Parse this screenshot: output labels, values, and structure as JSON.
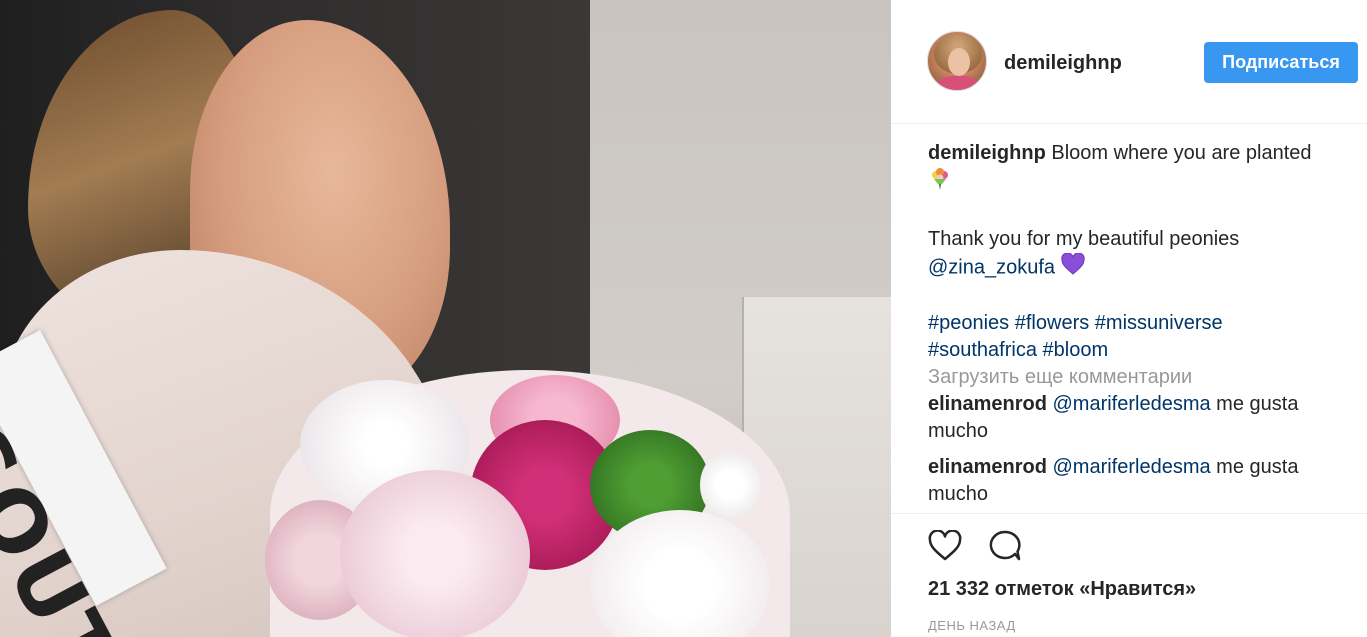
{
  "photo": {
    "sash_text": "SOUT"
  },
  "post": {
    "username": "demileighnp",
    "follow_label": "Подписаться",
    "caption": {
      "username": "demileighnp",
      "line1": "Bloom where you are planted",
      "line2": "Thank you for my beautiful peonies",
      "mention": "@zina_zokufa",
      "hashtags_line1": [
        "#peonies",
        "#flowers",
        "#missuniverse"
      ],
      "hashtags_line2": [
        "#southafrica",
        "#bloom"
      ]
    },
    "load_more": "Загрузить еще комментарии",
    "comments": [
      {
        "username": "elinamenrod",
        "mention": "@mariferledesma",
        "text": "me gusta mucho"
      },
      {
        "username": "elinamenrod",
        "mention": "@mariferledesma",
        "text": "me gusta mucho"
      }
    ],
    "likes": "21 332 отметок «Нравится»",
    "time": "ДЕНЬ НАЗАД"
  },
  "icons": {
    "like": "heart-outline-icon",
    "comment": "speech-bubble-icon",
    "bouquet_emoji": "bouquet-emoji",
    "purple_heart_emoji": "purple-heart-emoji"
  },
  "colors": {
    "follow_button": "#3897f0",
    "link": "#003569",
    "muted": "#999999",
    "purple_heart": "#8a4fd8"
  }
}
